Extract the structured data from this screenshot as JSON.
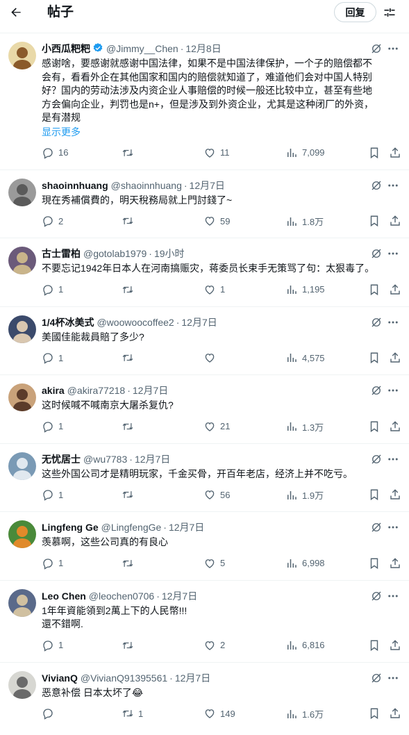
{
  "header": {
    "title": "帖子",
    "reply_label": "回复",
    "back_icon": "arrow-left-icon",
    "settings_icon": "sliders-icon"
  },
  "colors": {
    "accent": "#1d9bf0",
    "muted": "#536471",
    "divider": "#eff3f4"
  },
  "posts": [
    {
      "name": "小西瓜粑粑",
      "verified": true,
      "handle": "@Jimmy__Chen",
      "time": "12月8日",
      "text": "感谢啥，要感谢就感谢中国法律，如果不是中国法律保护，一个子的赔偿都不\n会有，看看外企在其他国家和国内的赔偿就知道了，难道他们会对中国人特别\n好？国内的劳动法涉及内资企业人事赔偿的时候一般还比较中立，甚至有些地\n方会偏向企业，判罚也是n+，但是涉及到外资企业，尤其是这种闭厂的外资，\n是有潜规",
      "show_more": "显示更多",
      "replies": "16",
      "retweets": "",
      "likes": "11",
      "views": "7,099"
    },
    {
      "name": "shaoinnhuang",
      "verified": false,
      "handle": "@shaoinnhuang",
      "time": "12月7日",
      "text": "現在秀補償費的，明天稅務局就上門討錢了~",
      "replies": "2",
      "retweets": "",
      "likes": "59",
      "views": "1.8万"
    },
    {
      "name": "古士雷柏",
      "verified": false,
      "handle": "@gotolab1979",
      "time": "19小时",
      "text": "不要忘记1942年日本人在河南搞赈灾，蒋委员长束手无策骂了句：太狠毒了。",
      "replies": "1",
      "retweets": "",
      "likes": "1",
      "views": "1,195"
    },
    {
      "name": "1/4杯冰美式",
      "verified": false,
      "handle": "@woowoocoffee2",
      "time": "12月7日",
      "text": "美國佳能裁員賠了多少?",
      "replies": "1",
      "retweets": "",
      "likes": "",
      "views": "4,575"
    },
    {
      "name": "akira",
      "verified": false,
      "handle": "@akira77218",
      "time": "12月7日",
      "text": "这时候喊不喊南京大屠杀复仇?",
      "replies": "1",
      "retweets": "",
      "likes": "21",
      "views": "1.3万"
    },
    {
      "name": "无忧居士",
      "verified": false,
      "handle": "@wu7783",
      "time": "12月7日",
      "text": "这些外国公司才是精明玩家，千金买骨，开百年老店，经济上并不吃亏。",
      "replies": "1",
      "retweets": "",
      "likes": "56",
      "views": "1.9万"
    },
    {
      "name": "Lingfeng Ge",
      "verified": false,
      "handle": "@LingfengGe",
      "time": "12月7日",
      "text": "羡慕啊，这些公司真的有良心",
      "replies": "1",
      "retweets": "",
      "likes": "5",
      "views": "6,998"
    },
    {
      "name": "Leo Chen",
      "verified": false,
      "handle": "@leochen0706",
      "time": "12月7日",
      "text": "1年年資能領到2萬上下的人民幣!!!\n還不錯啊.",
      "replies": "1",
      "retweets": "",
      "likes": "2",
      "views": "6,816"
    },
    {
      "name": "VivianQ",
      "verified": false,
      "handle": "@VivianQ91395561",
      "time": "12月7日",
      "text": "恶意补偿 日本太坏了😂",
      "replies": "",
      "retweets": "1",
      "likes": "149",
      "views": "1.6万"
    }
  ],
  "avatars": [
    {
      "bg": "#e9d9a8",
      "fg": "#8a5a2b",
      "icon": "monkey-avatar-icon"
    },
    {
      "bg": "#9a9a9a",
      "fg": "#5a5a5a",
      "icon": "cat-avatar-icon"
    },
    {
      "bg": "#6b5a7a",
      "fg": "#c9b48a",
      "icon": "ape-avatar-icon"
    },
    {
      "bg": "#3b4a6b",
      "fg": "#d9c7b0",
      "icon": "person-avatar-icon"
    },
    {
      "bg": "#c9a27a",
      "fg": "#5b3b2a",
      "icon": "hamster-avatar-icon"
    },
    {
      "bg": "#7a9ab5",
      "fg": "#e0e8ef",
      "icon": "scene-avatar-icon"
    },
    {
      "bg": "#4a8a3a",
      "fg": "#e08a2a",
      "icon": "cartoon-avatar-icon"
    },
    {
      "bg": "#5a6a8a",
      "fg": "#d0c0a0",
      "icon": "group-avatar-icon"
    },
    {
      "bg": "#d7d7d2",
      "fg": "#6a6a6a",
      "icon": "owl-avatar-icon"
    }
  ]
}
